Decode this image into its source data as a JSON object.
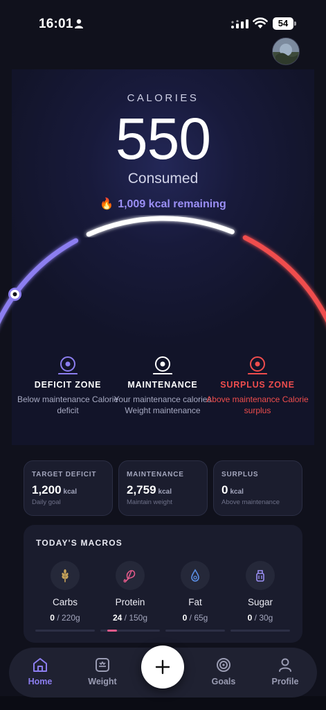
{
  "status_bar": {
    "time": "16:01",
    "battery": "54"
  },
  "calories": {
    "label": "CALORIES",
    "value": "550",
    "consumed_label": "Consumed",
    "remaining": "1,009 kcal remaining",
    "consumed_fraction": 0.353
  },
  "zones": [
    {
      "title": "DEFICIT ZONE",
      "desc": "Below maintenance Calorie deficit",
      "color": "#8c7ef0"
    },
    {
      "title": "MAINTENANCE",
      "desc": "Your maintenance calories Weight maintenance",
      "color": "#ffffff"
    },
    {
      "title": "SURPLUS ZONE",
      "desc": "Above maintenance Calorie surplus",
      "color": "#ef4d4d"
    }
  ],
  "stats": [
    {
      "label": "TARGET DEFICIT",
      "value": "1,200",
      "unit": "kcal",
      "sub": "Daily goal"
    },
    {
      "label": "MAINTENANCE",
      "value": "2,759",
      "unit": "kcal",
      "sub": "Maintain weight"
    },
    {
      "label": "SURPLUS",
      "value": "0",
      "unit": "kcal",
      "sub": "Above maintenance"
    }
  ],
  "macros": {
    "title": "TODAY'S MACROS",
    "items": [
      {
        "name": "Carbs",
        "current": "0",
        "goal": "/ 220g",
        "icon": "wheat-icon",
        "progress": 0
      },
      {
        "name": "Protein",
        "current": "24",
        "goal": "/ 150g",
        "icon": "meat-icon",
        "progress": 0.16
      },
      {
        "name": "Fat",
        "current": "0",
        "goal": "/ 65g",
        "icon": "droplet-icon",
        "progress": 0
      },
      {
        "name": "Sugar",
        "current": "0",
        "goal": "/ 30g",
        "icon": "candy-icon",
        "progress": 0
      }
    ]
  },
  "nav": {
    "home": "Home",
    "weight": "Weight",
    "goals": "Goals",
    "profile": "Profile"
  },
  "colors": {
    "accent": "#8c7ef0",
    "surplus": "#ef4d4d",
    "protein": "#e35a8a"
  }
}
